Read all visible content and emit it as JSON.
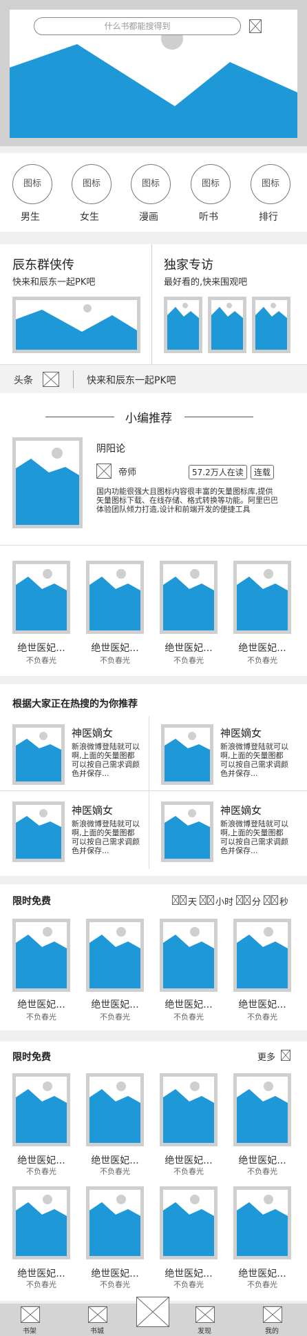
{
  "search": {
    "placeholder": "什么书都能搜得到"
  },
  "categories": [
    {
      "icon": "图标",
      "label": "男生"
    },
    {
      "icon": "图标",
      "label": "女生"
    },
    {
      "icon": "图标",
      "label": "漫画"
    },
    {
      "icon": "图标",
      "label": "听书"
    },
    {
      "icon": "图标",
      "label": "排行"
    }
  ],
  "promo_left": {
    "title": "辰东群侠传",
    "subtitle": "快来和辰东一起PK吧"
  },
  "promo_right": {
    "title": "独家专访",
    "subtitle": "最好看的,快来围观吧"
  },
  "headline": {
    "label": "头条",
    "text": "快来和辰东一起PK吧"
  },
  "editor_pick": {
    "section_title": "小编推荐",
    "book_title": "阴阳论",
    "author": "帝师",
    "readers": "57.2万人在读",
    "status": "连载",
    "description": "国内功能很强大且图标内容很丰富的矢量图标库,提供矢量图标下载、在线存储、格式转换等功能。阿里巴巴体验团队倾力打造,设计和前端开发的便捷工具"
  },
  "row_books": [
    {
      "title": "绝世医妃...",
      "sub": "不负春光"
    },
    {
      "title": "绝世医妃...",
      "sub": "不负春光"
    },
    {
      "title": "绝世医妃...",
      "sub": "不负春光"
    },
    {
      "title": "绝世医妃...",
      "sub": "不负春光"
    }
  ],
  "hot": {
    "title": "根据大家正在热搜的为你推荐",
    "items": [
      {
        "title": "神医嫡女",
        "desc": "新浪微博登陆就可以啊,上面的矢量图都可以按自己需求调颜色并保存..."
      },
      {
        "title": "神医嫡女",
        "desc": "新浪微博登陆就可以啊,上面的矢量图都可以按自己需求调颜色并保存..."
      },
      {
        "title": "神医嫡女",
        "desc": "新浪微博登陆就可以啊,上面的矢量图都可以按自己需求调颜色并保存..."
      },
      {
        "title": "神医嫡女",
        "desc": "新浪微博登陆就可以啊,上面的矢量图都可以按自己需求调颜色并保存..."
      }
    ]
  },
  "free1": {
    "title": "限时免费",
    "countdown": {
      "day": "天",
      "hour": "小时",
      "min": "分",
      "sec": "秒"
    },
    "books": [
      {
        "title": "绝世医妃...",
        "sub": "不负春光"
      },
      {
        "title": "绝世医妃...",
        "sub": "不负春光"
      },
      {
        "title": "绝世医妃...",
        "sub": "不负春光"
      },
      {
        "title": "绝世医妃...",
        "sub": "不负春光"
      }
    ]
  },
  "free2": {
    "title": "限时免费",
    "more": "更多",
    "books": [
      {
        "title": "绝世医妃...",
        "sub": "不负春光"
      },
      {
        "title": "绝世医妃...",
        "sub": "不负春光"
      },
      {
        "title": "绝世医妃...",
        "sub": "不负春光"
      },
      {
        "title": "绝世医妃...",
        "sub": "不负春光"
      },
      {
        "title": "绝世医妃...",
        "sub": "不负春光"
      },
      {
        "title": "绝世医妃...",
        "sub": "不负春光"
      },
      {
        "title": "绝世医妃...",
        "sub": "不负春光"
      },
      {
        "title": "绝世医妃...",
        "sub": "不负春光"
      }
    ]
  },
  "tabbar": [
    {
      "label": "书架"
    },
    {
      "label": "书城"
    },
    {
      "label": ""
    },
    {
      "label": "发现"
    },
    {
      "label": "我的"
    }
  ],
  "colors": {
    "accent": "#1e98d7",
    "placeholder_frame": "#cfcfcf"
  }
}
